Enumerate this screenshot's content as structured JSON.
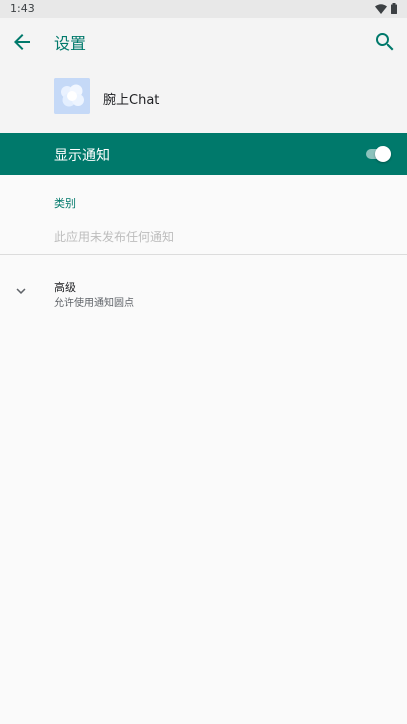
{
  "status_bar": {
    "time": "1:43",
    "icons": [
      "wifi-icon",
      "battery-icon"
    ]
  },
  "app_bar": {
    "title": "设置",
    "back_icon": "arrow-left-icon",
    "search_icon": "search-icon"
  },
  "app_header": {
    "app_name": "腕上Chat",
    "app_icon": "app-logo-icon"
  },
  "notifications": {
    "show_label": "显示通知",
    "enabled": true
  },
  "categories": {
    "title": "类别",
    "empty_text": "此应用未发布任何通知"
  },
  "advanced": {
    "title": "高级",
    "subtitle": "允许使用通知圆点",
    "icon": "chevron-down-icon"
  },
  "colors": {
    "accent": "#00796b",
    "background": "#fafafa",
    "app_icon_bg": "#c5d9f7"
  }
}
